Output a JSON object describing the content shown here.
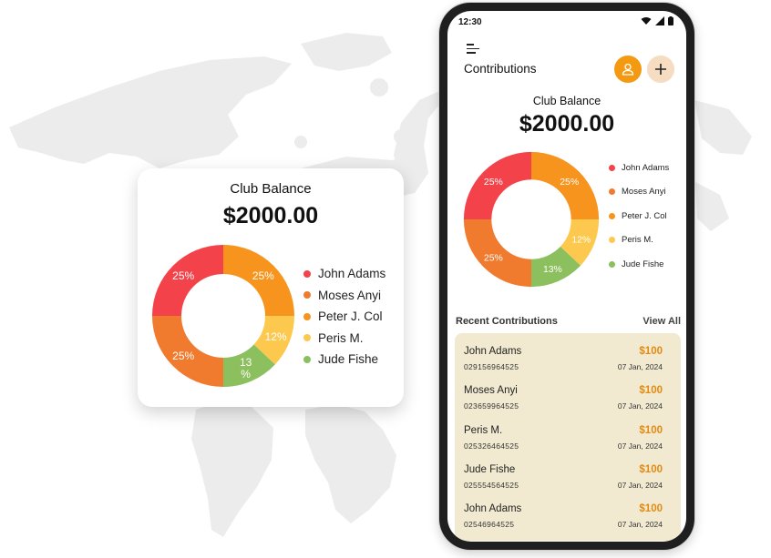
{
  "colors": {
    "red": "#f4424a",
    "orange_dark": "#f07a2e",
    "orange": "#f7941d",
    "yellow": "#fcc94e",
    "green": "#8cbf5e",
    "accent": "#f39a12",
    "list_bg": "#f1ead1"
  },
  "card": {
    "title": "Club Balance",
    "amount": "$2000.00"
  },
  "chart_data": [
    {
      "type": "pie",
      "title": "Club Balance",
      "categories": [
        "John Adams",
        "Moses Anyi",
        "Peter J. Col",
        "Peris M.",
        "Jude Fishe"
      ],
      "labels": [
        "25%",
        "25%",
        "25%",
        "12%",
        "13\n%"
      ],
      "series": [
        {
          "values": [
            25,
            25,
            25,
            12,
            13
          ]
        }
      ],
      "legend": "right"
    },
    {
      "type": "pie",
      "title": "Club Balance",
      "categories": [
        "John Adams",
        "Moses Anyi",
        "Peter J. Col",
        "Peris M.",
        "Jude Fishe"
      ],
      "labels": [
        "25%",
        "25%",
        "25%",
        "12%",
        "13%"
      ],
      "series": [
        {
          "values": [
            25,
            25,
            25,
            12,
            13
          ]
        }
      ],
      "legend": "right"
    }
  ],
  "phone": {
    "status_time": "12:30",
    "page_title": "Contributions",
    "balance_title": "Club Balance",
    "balance_amount": "$2000.00",
    "recent_title": "Recent Contributions",
    "view_all": "View All",
    "contributions": [
      {
        "name": "John Adams",
        "phone": "029156964525",
        "amount": "$100",
        "date": "07 Jan, 2024"
      },
      {
        "name": "Moses Anyi",
        "phone": "023659964525",
        "amount": "$100",
        "date": "07 Jan, 2024"
      },
      {
        "name": "Peris M.",
        "phone": "025326464525",
        "amount": "$100",
        "date": "07 Jan, 2024"
      },
      {
        "name": "Jude Fishe",
        "phone": "025554564525",
        "amount": "$100",
        "date": "07 Jan, 2024"
      },
      {
        "name": "John Adams",
        "phone": "02546964525",
        "amount": "$100",
        "date": "07 Jan, 2024"
      }
    ]
  },
  "icons": {
    "menu": "menu-icon",
    "user": "user-icon",
    "add": "plus-icon",
    "wifi": "wifi-icon",
    "signal": "signal-icon",
    "battery": "battery-icon"
  }
}
